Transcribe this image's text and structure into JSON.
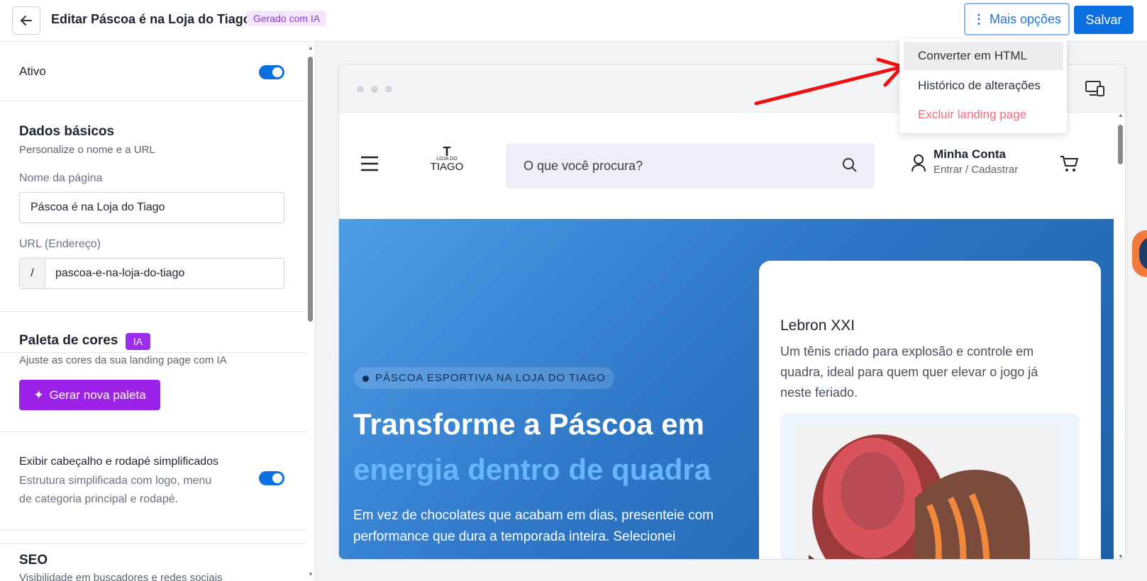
{
  "header": {
    "title": "Editar Páscoa é na Loja do Tiago",
    "badge": "Gerado com IA",
    "more_label": "Mais opções",
    "save_label": "Salvar"
  },
  "menu": {
    "items": [
      "Converter em HTML",
      "Histórico de alterações",
      "Excluir landing page"
    ]
  },
  "sidebar": {
    "active_label": "Ativo",
    "active_on": true,
    "basic": {
      "title": "Dados básicos",
      "subtitle": "Personalize o nome e a URL",
      "name_label": "Nome da página",
      "name_value": "Páscoa é na Loja do Tiago",
      "url_label": "URL (Endereço)",
      "url_prefix": "/",
      "url_value": "pascoa-e-na-loja-do-tiago"
    },
    "palette": {
      "title": "Paleta de cores",
      "badge": "IA",
      "subtitle": "Ajuste as cores da sua landing page com IA",
      "button": "Gerar nova paleta"
    },
    "simplified": {
      "title": "Exibir cabeçalho e rodapé simplificados",
      "desc_line1": "Estrutura simplificada com logo, menu",
      "desc_line2": "de categoria principal e rodapé.",
      "on": true
    },
    "seo": {
      "title": "SEO",
      "subtitle": "Visibilidade em buscadores e redes sociais"
    }
  },
  "preview": {
    "logo_top": "LOJA DO",
    "logo_bottom": "TIAGO",
    "search_placeholder": "O que você procura?",
    "account_title": "Minha Conta",
    "account_sub": "Entrar / Cadastrar",
    "hero": {
      "tag": "PÁSCOA ESPORTIVA NA LOJA DO TIAGO",
      "title_line1": "Transforme a Páscoa em",
      "title_line2": "energia dentro de quadra",
      "text": "Em vez de chocolates que acabam em dias, presenteie com performance que dura a temporada inteira. Selecionei"
    },
    "card": {
      "title": "Lebron XXI",
      "desc": "Um tênis criado para explosão e controle em quadra, ideal para quem quer elevar o jogo já neste feriado."
    }
  },
  "colors": {
    "primary": "#0b6fe0",
    "purple": "#9b22e6",
    "danger": "#f06a7e",
    "annotation": "#f01010"
  }
}
